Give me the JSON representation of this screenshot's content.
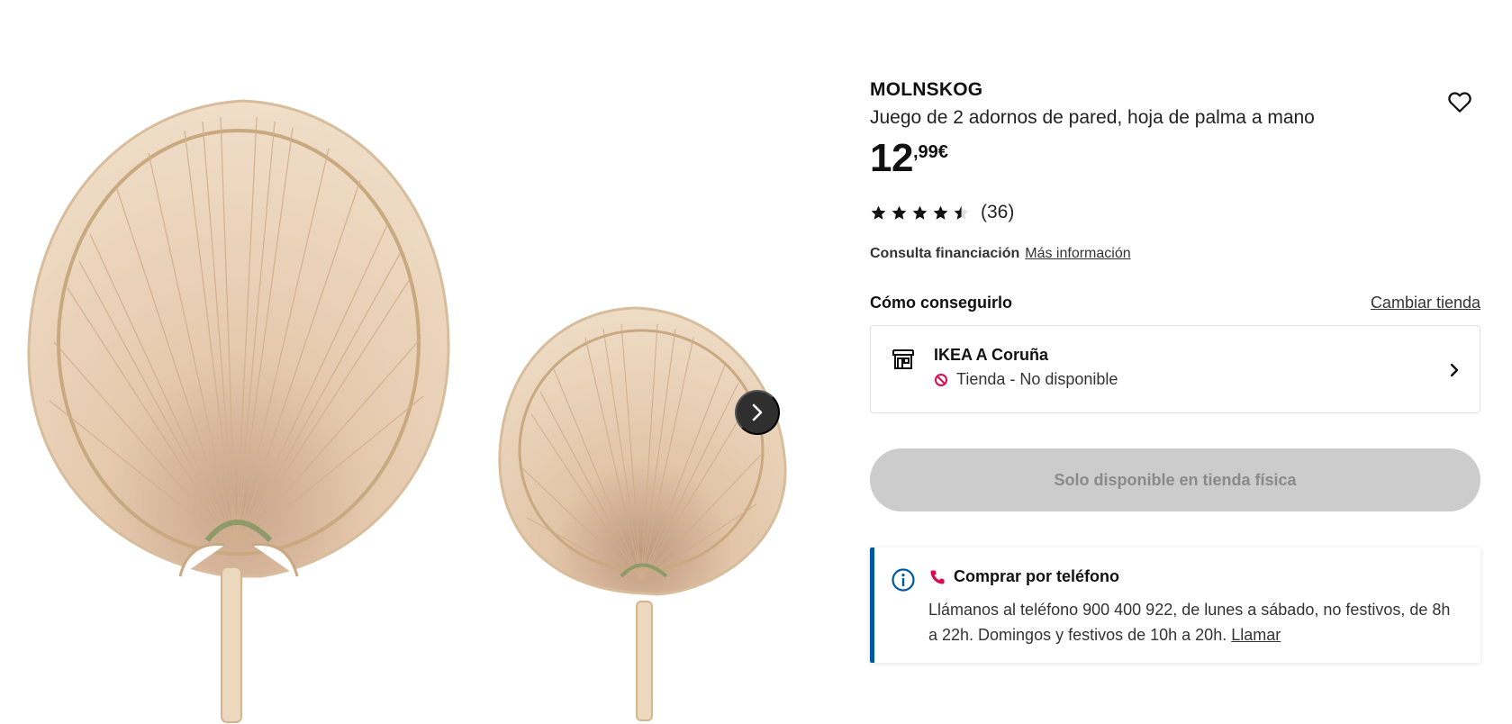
{
  "gallery": {
    "image_alt": "MOLNSKOG",
    "next_button_label": "Siguiente imagen"
  },
  "product": {
    "name": "MOLNSKOG",
    "description": "Juego de 2 adornos de pared, hoja de palma a mano",
    "price_integer": "12",
    "price_decimal": ",99€",
    "rating_value": 4.5,
    "rating_max": 5,
    "review_count": "(36)",
    "favourite_icon": "heart-icon"
  },
  "financing": {
    "label": "Consulta financiación",
    "link": "Más información"
  },
  "availability": {
    "title": "Cómo conseguirlo",
    "change_store": "Cambiar tienda",
    "store_name": "IKEA A Coruña",
    "store_status": "Tienda - No disponible",
    "status_color": "#e00751"
  },
  "cta": {
    "label": "Solo disponible en tienda física"
  },
  "phone": {
    "title": "Comprar por teléfono",
    "body": "Llámanos al teléfono 900 400 922, de lunes a sábado, no festivos, de 8h a 22h. Domingos y festivos de 10h a 20h.",
    "call_link": "Llamar",
    "accent_color": "#0058a3",
    "phone_icon_color": "#e00751"
  }
}
